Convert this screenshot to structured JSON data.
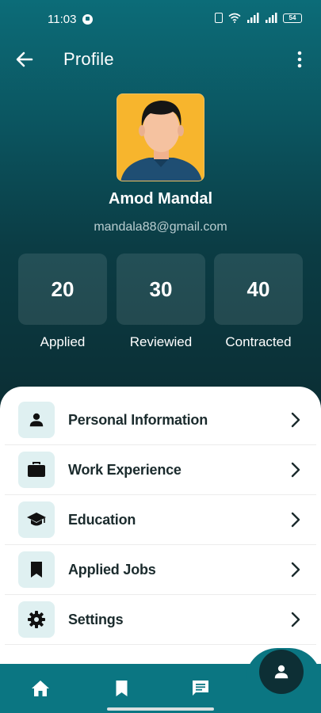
{
  "status_bar": {
    "time": "11:03",
    "battery": "54"
  },
  "header": {
    "title": "Profile"
  },
  "profile": {
    "name": "Amod Mandal",
    "email": "mandala88@gmail.com"
  },
  "stats": [
    {
      "value": "20",
      "label": "Applied"
    },
    {
      "value": "30",
      "label": "Reviewied"
    },
    {
      "value": "40",
      "label": "Contracted"
    }
  ],
  "menu": [
    {
      "label": "Personal Information",
      "icon": "person-icon"
    },
    {
      "label": "Work Experience",
      "icon": "briefcase-icon"
    },
    {
      "label": "Education",
      "icon": "graduation-cap-icon"
    },
    {
      "label": "Applied Jobs",
      "icon": "bookmark-icon"
    },
    {
      "label": "Settings",
      "icon": "gear-icon"
    }
  ],
  "bottom_nav": [
    {
      "name": "home",
      "icon": "home-icon"
    },
    {
      "name": "saved",
      "icon": "bookmark-icon"
    },
    {
      "name": "messages",
      "icon": "chat-icon"
    },
    {
      "name": "profile",
      "icon": "person-icon",
      "active": true
    }
  ],
  "colors": {
    "primary": "#0b7682",
    "dark": "#0d2f35",
    "icon_bg": "#dff0f1",
    "avatar_bg": "#f7b52d"
  }
}
